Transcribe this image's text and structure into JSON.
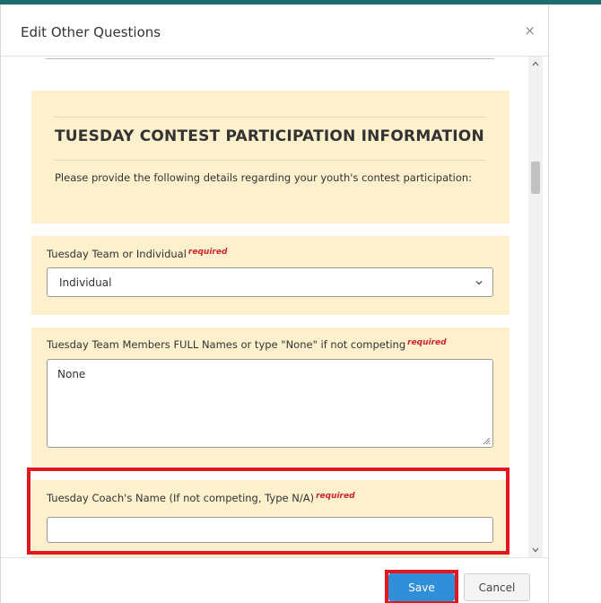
{
  "modal": {
    "title": "Edit Other Questions",
    "close_symbol": "×"
  },
  "info_section": {
    "title": "TUESDAY CONTEST PARTICIPATION INFORMATION",
    "description": "Please provide the following details regarding your youth's contest participation:"
  },
  "team_field": {
    "label": "Tuesday Team or Individual",
    "required": "required",
    "selected_value": "Individual"
  },
  "members_field": {
    "label": "Tuesday Team Members FULL Names or type \"None\" if not competing",
    "required": "required",
    "value": "None"
  },
  "coach_field": {
    "label": "Tuesday Coach's Name (If not competing, Type N/A)",
    "required": "required",
    "value": ""
  },
  "footer": {
    "save_label": "Save",
    "cancel_label": "Cancel"
  },
  "colors": {
    "accent_bar": "#1b6e6e",
    "section_bg": "#fdf0cd",
    "highlight": "#e3171f",
    "save_button": "#2f8fd8",
    "required_text": "#d0232b"
  },
  "icons": {
    "close": "close-icon",
    "select": "chevron-down-icon",
    "scroll_up": "chevron-up-icon",
    "scroll_down": "chevron-down-icon",
    "resize": "resize-grip-icon"
  }
}
